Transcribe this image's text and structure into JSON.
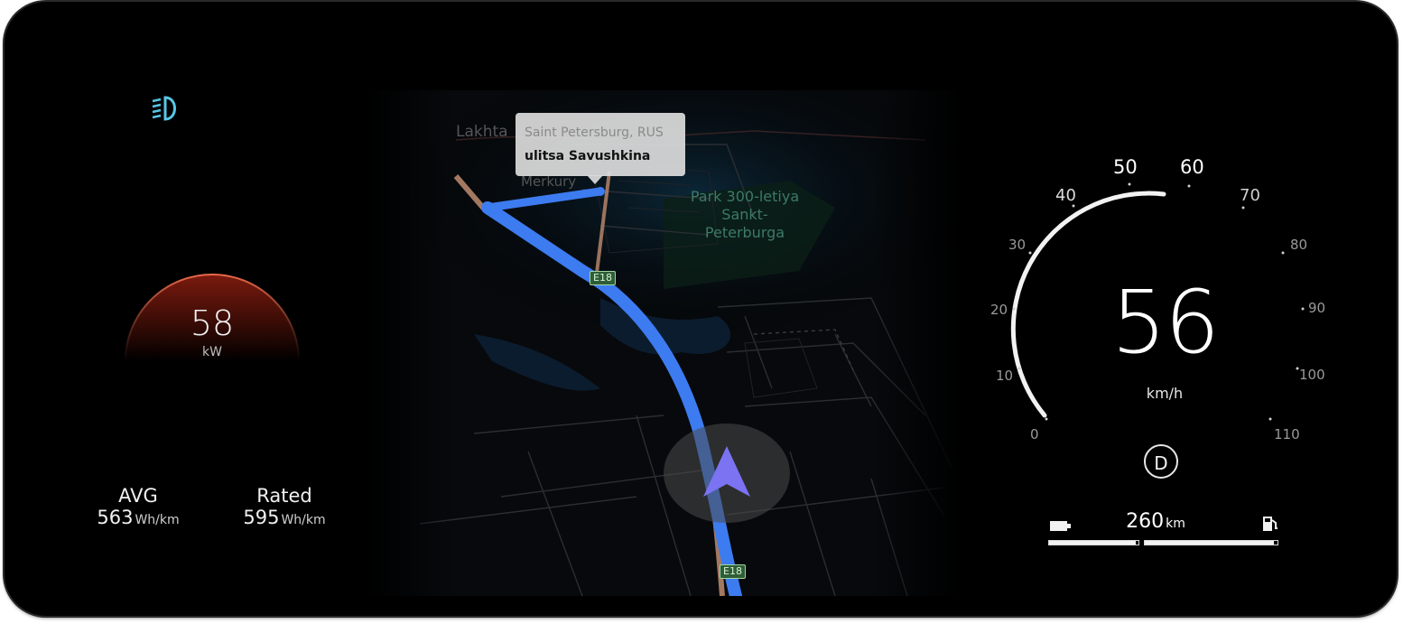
{
  "left_panel": {
    "power": {
      "value": "58",
      "unit": "kW"
    },
    "avg": {
      "label": "AVG",
      "value": "563",
      "unit": "Wh/km"
    },
    "rated": {
      "label": "Rated",
      "value": "595",
      "unit": "Wh/km"
    },
    "icons": {
      "headlight": "low-beam-headlight-icon"
    }
  },
  "map": {
    "tooltip": {
      "city": "Saint Petersburg, RUS",
      "street": "ulitsa Savushkina"
    },
    "labels": {
      "park": [
        "Park 300-letiya",
        "Sankt-",
        "Peterburga"
      ],
      "top_left": "Lakhta",
      "merkury": "Merkury"
    },
    "road_shields": [
      "E18",
      "E18"
    ],
    "colors": {
      "route": "#3d7bf0",
      "vehicle": "#7b73f2",
      "road": "#c9926e"
    }
  },
  "speedometer": {
    "speed": "56",
    "unit": "km/h",
    "ticks": [
      "0",
      "10",
      "20",
      "30",
      "40",
      "50",
      "60",
      "70",
      "80",
      "90",
      "100",
      "110"
    ],
    "gear": "D",
    "range": {
      "value": "260",
      "unit": "km"
    },
    "battery_level": 0.97,
    "fuel_level": 0.97,
    "icons": {
      "battery": "battery-icon",
      "fuel": "fuel-pump-icon"
    }
  }
}
